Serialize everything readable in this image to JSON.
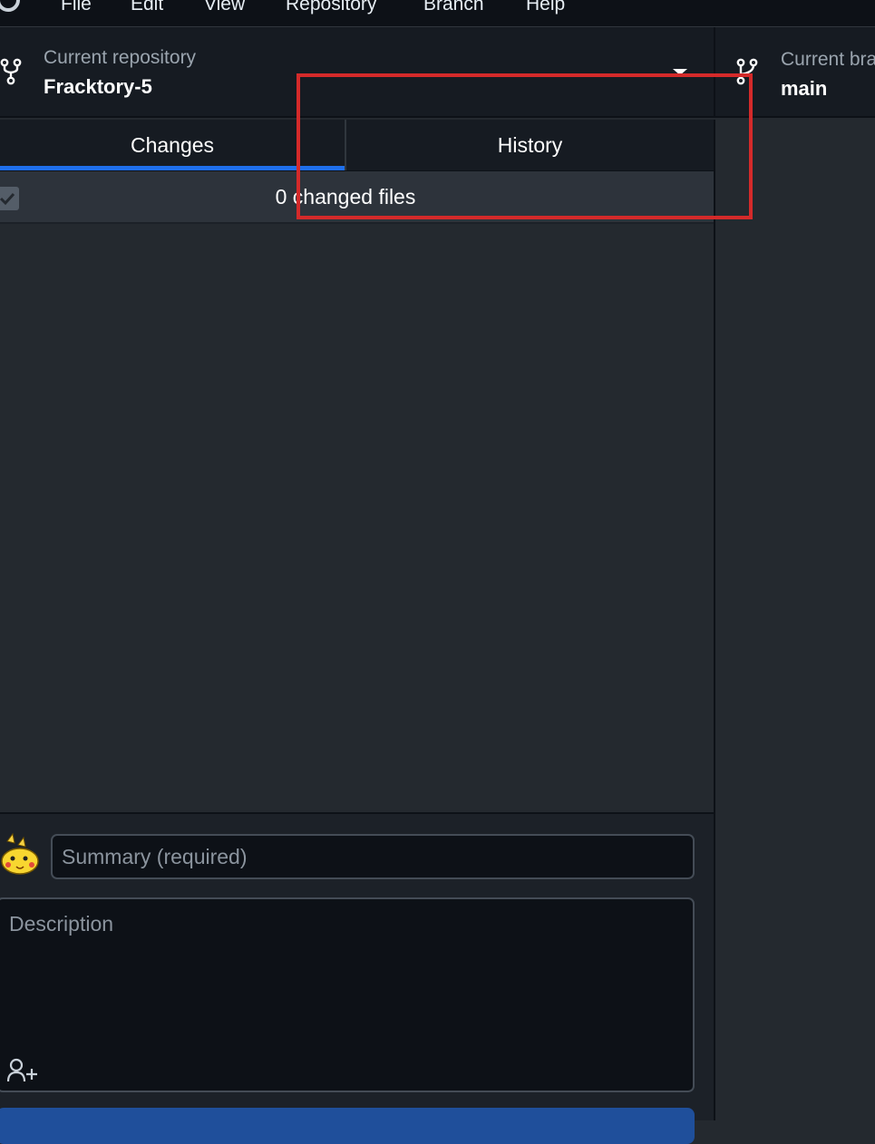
{
  "menu": {
    "items": [
      "File",
      "Edit",
      "View",
      "Repository",
      "Branch",
      "Help"
    ]
  },
  "toolbar": {
    "repo_label": "Current repository",
    "repo_name": "Fracktory-5",
    "branch_label": "Current bra",
    "branch_name": "main"
  },
  "tabs": {
    "changes": "Changes",
    "history": "History"
  },
  "changes": {
    "count_text": "0 changed files"
  },
  "commit": {
    "summary_placeholder": "Summary (required)",
    "description_placeholder": "Description"
  },
  "colors": {
    "accent": "#1f6feb",
    "highlight": "#d42a2a",
    "background": "#24292f"
  },
  "icons": [
    "github-logo-icon",
    "repo-fork-icon",
    "branch-icon",
    "chevron-down-icon",
    "checkmark-icon",
    "avatar-pikachu",
    "add-coauthor-icon"
  ]
}
